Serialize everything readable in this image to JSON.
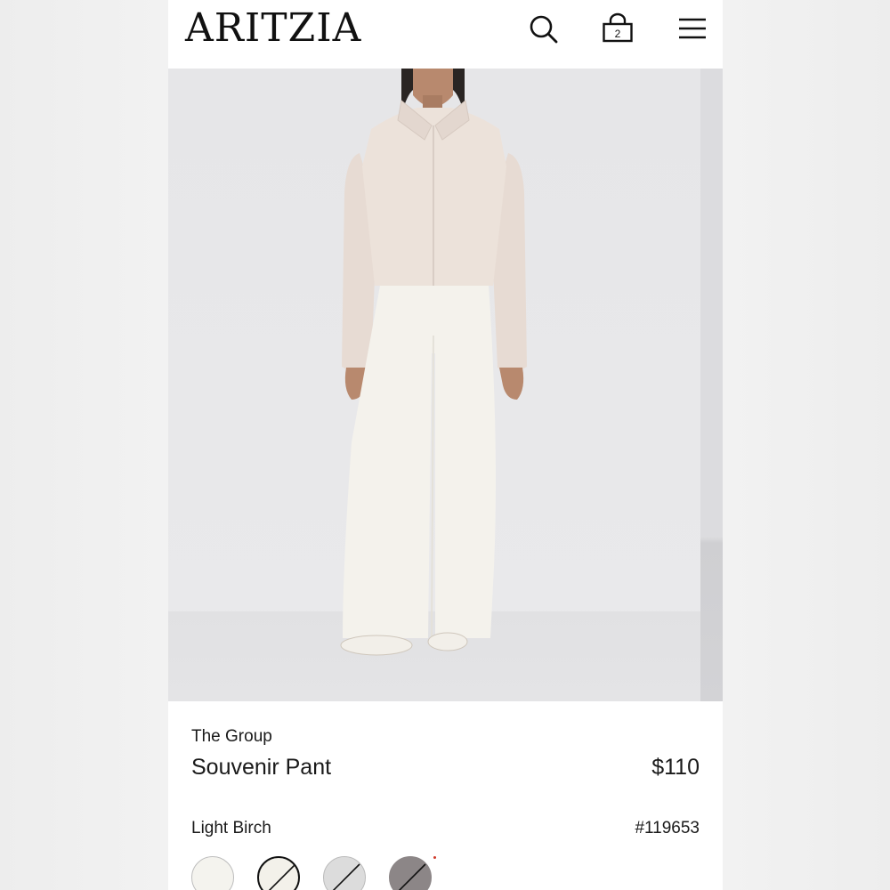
{
  "header": {
    "logo": "ARITZIA",
    "bag_count": "2",
    "icons": [
      "search-icon",
      "shopping-bag-icon",
      "hamburger-menu-icon"
    ]
  },
  "product": {
    "brand": "The Group",
    "name": "Souvenir Pant",
    "price": "$110",
    "color_name": "Light Birch",
    "sku": "#119653"
  },
  "swatches": [
    {
      "name": "light-birch",
      "color": "#f4f3ee",
      "available": true
    },
    {
      "name": "ivory",
      "color": "#f3f1ea",
      "available": false,
      "selected": true
    },
    {
      "name": "heather-grey",
      "color": "#dcdcdc",
      "available": false
    },
    {
      "name": "taupe",
      "color": "#8c8687",
      "available": false
    }
  ],
  "colors": {
    "text": "#1a1a1a",
    "hero_bg": "#e6e6e8",
    "accent_dot": "#d03a2a"
  }
}
